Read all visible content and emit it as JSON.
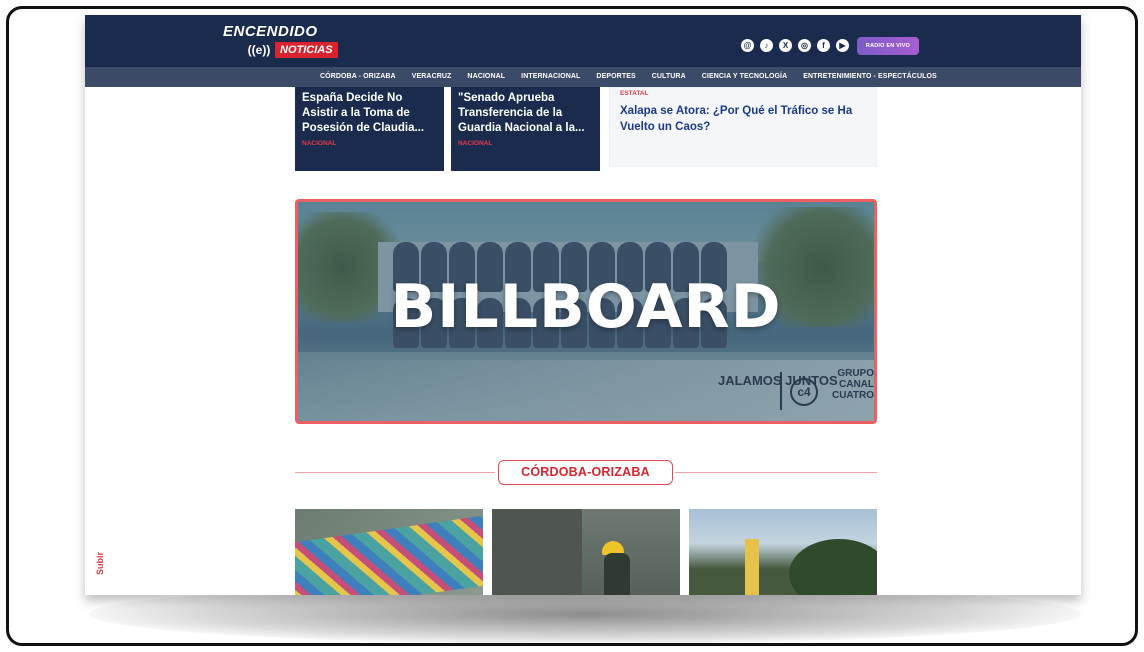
{
  "header": {
    "logo_top": "ENCENDIDO",
    "logo_mark": "((e))",
    "logo_badge": "NOTICIAS",
    "social_icons": [
      "threads-icon",
      "tiktok-icon",
      "x-icon",
      "instagram-icon",
      "facebook-icon",
      "youtube-icon"
    ],
    "radio_button": "RADIO EN VIVO"
  },
  "nav": {
    "items": [
      "CÓRDOBA - ORIZABA",
      "VERACRUZ",
      "NACIONAL",
      "INTERNACIONAL",
      "DEPORTES",
      "CULTURA",
      "CIENCIA Y TECNOLOGÍA",
      "ENTRETENIMIENTO - ESPECTÁCULOS"
    ]
  },
  "cards": [
    {
      "title": "España Decide No Asistir a la Toma de Posesión de Claudia...",
      "category": "NACIONAL"
    },
    {
      "title": "\"Senado Aprueba Transferencia de la Guardia Nacional a la...",
      "category": "NACIONAL"
    },
    {
      "title": "Xalapa se Atora: ¿Por Qué el Tráfico se Ha Vuelto un Caos?",
      "category": "ESTATAL"
    }
  ],
  "billboard": {
    "label": "BILLBOARD",
    "brand_1": "JALAMOS JUNTOS",
    "brand_2": "GRUPO CANAL CUATRO",
    "brand_mark": "c4"
  },
  "section": {
    "title": "CÓRDOBA-ORIZABA"
  },
  "side": {
    "subir": "Subir"
  },
  "colors": {
    "navy": "#1b2b4d",
    "nav_gray": "#3b4a66",
    "accent_red": "#d9232e",
    "link_blue": "#1b3a8a",
    "billboard_border": "#ec5f63"
  }
}
